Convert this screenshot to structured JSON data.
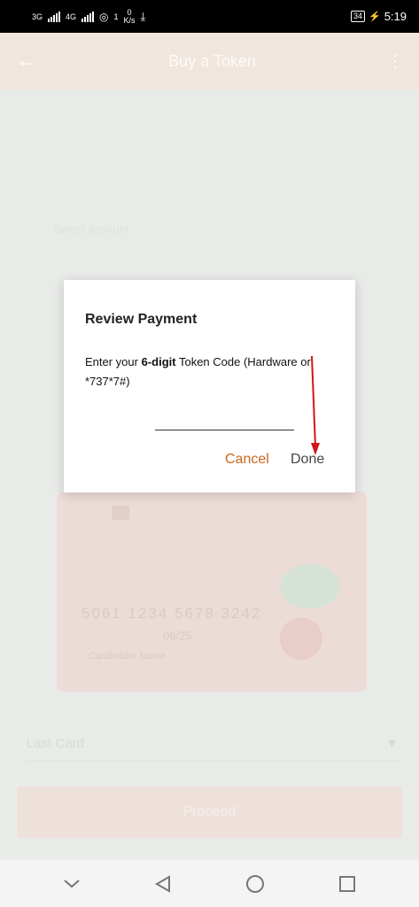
{
  "status_bar": {
    "net1": "3G",
    "net2": "4G",
    "speed_value": "0",
    "speed_unit": "K/s",
    "speed_prefix": "1",
    "battery": "34",
    "time": "5:19"
  },
  "background_app": {
    "title": "Buy a Token",
    "ghost_line": "Select account",
    "card_number": "5061 1234 5678 3242",
    "card_expiry": "06/25",
    "card_holder": "Cardholder Name",
    "field_label": "Last Card",
    "primary_button": "Proceed"
  },
  "dialog": {
    "title": "Review Payment",
    "message_prefix": "Enter your ",
    "message_bold": "6-digit",
    "message_suffix": " Token Code (Hardware or *737*7#)",
    "input_value": "",
    "input_placeholder": "",
    "cancel_label": "Cancel",
    "done_label": "Done"
  },
  "annotation": {
    "arrow_color": "#d0161b"
  },
  "colors": {
    "accent": "#c9651c"
  },
  "nav_bar": {
    "icons": [
      "chevron-down-icon",
      "back-triangle-icon",
      "home-circle-icon",
      "recents-square-icon"
    ]
  }
}
